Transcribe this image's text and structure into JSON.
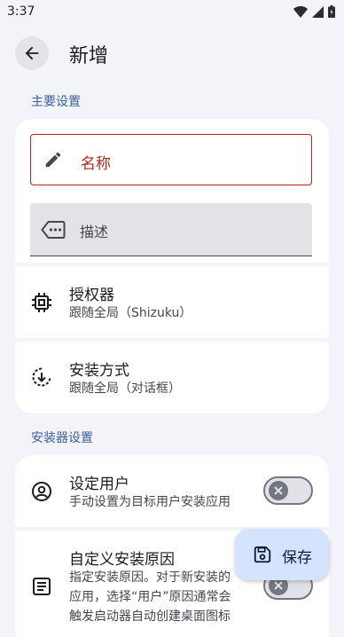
{
  "status_bar": {
    "time": "3:37",
    "icons": [
      "wifi-icon",
      "signal-icon",
      "battery-icon"
    ]
  },
  "header": {
    "title": "新增",
    "back_icon": "arrow-back-icon"
  },
  "sections": {
    "main": "主要设置",
    "installer": "安装器设置"
  },
  "form": {
    "name_label": "名称",
    "description_label": "描述"
  },
  "settings": {
    "authorizer": {
      "title": "授权器",
      "subtitle": "跟随全局（Shizuku）"
    },
    "install_method": {
      "title": "安装方式",
      "subtitle": "跟随全局（对话框）"
    },
    "set_user": {
      "title": "设定用户",
      "subtitle": "手动设置为目标用户安装应用",
      "enabled": false
    },
    "custom_reason": {
      "title": "自定义安装原因",
      "subtitle_lines": [
        "指定安装原因。对于新安装的",
        "应用，选择“用户”原因通常会",
        "触发启动器自动创建桌面图标"
      ],
      "enabled": false
    }
  },
  "fab": {
    "label": "保存",
    "icon": "save-icon"
  },
  "colors": {
    "background": "#f3f4f9",
    "accent": "#3b5f9a",
    "error": "#b3261e",
    "fab": "#d6e3ff"
  }
}
